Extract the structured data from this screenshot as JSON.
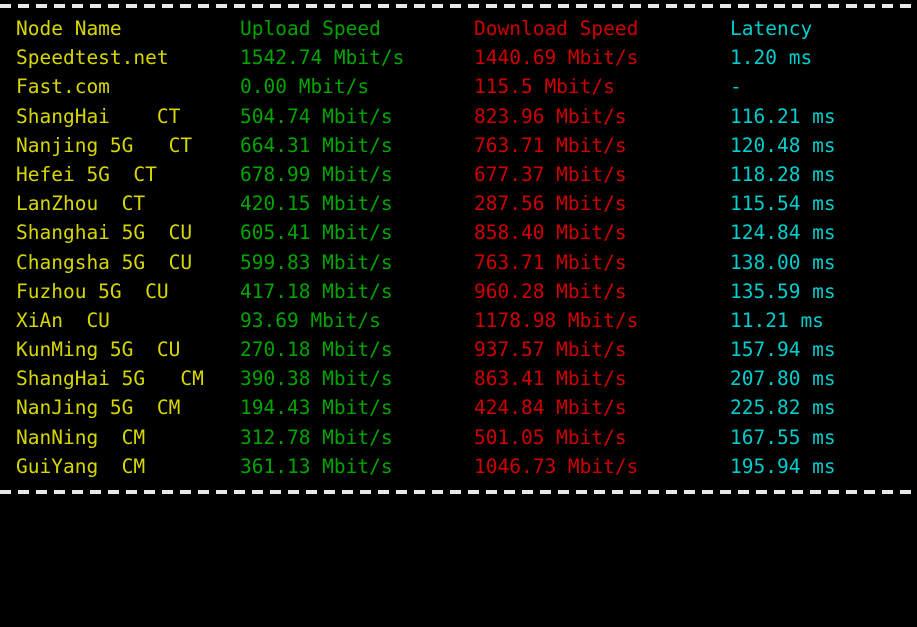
{
  "terminal": {
    "separator_top": "dashed-rule",
    "separator_bottom": "dashed-rule",
    "colors": {
      "background": "#000000",
      "header_text": "#ffffff",
      "node_name": "#d7d700",
      "upload_speed": "#00a500",
      "download_speed": "#d00000",
      "latency": "#00cdcd"
    }
  },
  "table": {
    "headers": {
      "node_name": "Node Name",
      "upload_speed": "Upload Speed",
      "download_speed": "Download Speed",
      "latency": "Latency"
    },
    "rows": [
      {
        "node_name": "Speedtest.net",
        "upload_speed": "1542.74 Mbit/s",
        "download_speed": "1440.69 Mbit/s",
        "latency": "1.20 ms"
      },
      {
        "node_name": "Fast.com",
        "upload_speed": "0.00 Mbit/s",
        "download_speed": "115.5 Mbit/s",
        "latency": "-"
      },
      {
        "node_name": "ShangHai    CT",
        "upload_speed": "504.74 Mbit/s",
        "download_speed": "823.96 Mbit/s",
        "latency": "116.21 ms"
      },
      {
        "node_name": "Nanjing 5G   CT",
        "upload_speed": "664.31 Mbit/s",
        "download_speed": "763.71 Mbit/s",
        "latency": "120.48 ms"
      },
      {
        "node_name": "Hefei 5G  CT",
        "upload_speed": "678.99 Mbit/s",
        "download_speed": "677.37 Mbit/s",
        "latency": "118.28 ms"
      },
      {
        "node_name": "LanZhou  CT",
        "upload_speed": "420.15 Mbit/s",
        "download_speed": "287.56 Mbit/s",
        "latency": "115.54 ms"
      },
      {
        "node_name": "Shanghai 5G  CU",
        "upload_speed": "605.41 Mbit/s",
        "download_speed": "858.40 Mbit/s",
        "latency": "124.84 ms"
      },
      {
        "node_name": "Changsha 5G  CU",
        "upload_speed": "599.83 Mbit/s",
        "download_speed": "763.71 Mbit/s",
        "latency": "138.00 ms"
      },
      {
        "node_name": "Fuzhou 5G  CU",
        "upload_speed": "417.18 Mbit/s",
        "download_speed": "960.28 Mbit/s",
        "latency": "135.59 ms"
      },
      {
        "node_name": "XiAn  CU",
        "upload_speed": "93.69 Mbit/s",
        "download_speed": "1178.98 Mbit/s",
        "latency": "11.21 ms"
      },
      {
        "node_name": "KunMing 5G  CU",
        "upload_speed": "270.18 Mbit/s",
        "download_speed": "937.57 Mbit/s",
        "latency": "157.94 ms"
      },
      {
        "node_name": "ShangHai 5G   CM",
        "upload_speed": "390.38 Mbit/s",
        "download_speed": "863.41 Mbit/s",
        "latency": "207.80 ms"
      },
      {
        "node_name": "NanJing 5G  CM",
        "upload_speed": "194.43 Mbit/s",
        "download_speed": "424.84 Mbit/s",
        "latency": "225.82 ms"
      },
      {
        "node_name": "NanNing  CM",
        "upload_speed": "312.78 Mbit/s",
        "download_speed": "501.05 Mbit/s",
        "latency": "167.55 ms"
      },
      {
        "node_name": "GuiYang  CM",
        "upload_speed": "361.13 Mbit/s",
        "download_speed": "1046.73 Mbit/s",
        "latency": "195.94 ms"
      }
    ]
  }
}
